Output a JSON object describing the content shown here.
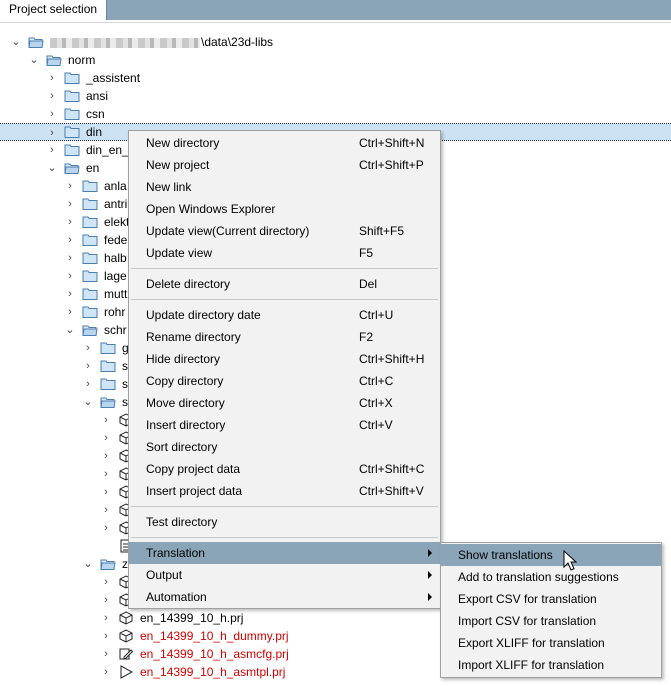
{
  "title_tab": "Project selection",
  "root_path": "\\data\\23d-libs",
  "tree": {
    "norm": "norm",
    "assistent": "_assistent",
    "ansi": "ansi",
    "csn": "csn",
    "din": "din",
    "din_en": "din_en_",
    "en": "en",
    "en_children": [
      "anla",
      "antri",
      "elekt",
      "fede",
      "halb",
      "lage",
      "mutt",
      "rohr",
      "schr"
    ],
    "schr_children": [
      "g",
      "s",
      "s",
      "s"
    ],
    "z_label": "z",
    "projects": [
      {
        "label": "en_14399_10_h.prj",
        "red": false
      },
      {
        "label": "en_14399_10_h_dummy.prj",
        "red": true
      },
      {
        "label": "en_14399_10_h_asmcfg.prj",
        "red": true
      },
      {
        "label": "en_14399_10_h_asmtpl.prj",
        "red": true
      }
    ]
  },
  "context_menu": [
    {
      "label": "New directory",
      "key": "Ctrl+Shift+N"
    },
    {
      "label": "New project",
      "key": "Ctrl+Shift+P"
    },
    {
      "label": "New link",
      "key": ""
    },
    {
      "label": "Open Windows Explorer",
      "key": ""
    },
    {
      "label": "Update view(Current directory)",
      "key": "Shift+F5"
    },
    {
      "label": "Update view",
      "key": "F5"
    },
    {
      "label": "Delete directory",
      "key": "Del"
    },
    {
      "label": "Update directory date",
      "key": "Ctrl+U"
    },
    {
      "label": "Rename directory",
      "key": "F2"
    },
    {
      "label": "Hide directory",
      "key": "Ctrl+Shift+H"
    },
    {
      "label": "Copy directory",
      "key": "Ctrl+C"
    },
    {
      "label": "Move directory",
      "key": "Ctrl+X"
    },
    {
      "label": "Insert directory",
      "key": "Ctrl+V"
    },
    {
      "label": "Sort directory",
      "key": ""
    },
    {
      "label": "Copy project data",
      "key": "Ctrl+Shift+C"
    },
    {
      "label": "Insert project data",
      "key": "Ctrl+Shift+V"
    },
    {
      "label": "Test directory",
      "key": ""
    },
    {
      "label": "Translation",
      "key": ""
    },
    {
      "label": "Output",
      "key": ""
    },
    {
      "label": "Automation",
      "key": ""
    }
  ],
  "submenu": [
    "Show translations",
    "Add to translation suggestions",
    "Export CSV for translation",
    "Import CSV for translation",
    "Export XLIFF for translation",
    "Import XLIFF for translation"
  ],
  "colors": {
    "highlight": "#8aa5b8",
    "selection": "#cde3f3",
    "red_text": "#d40000"
  }
}
